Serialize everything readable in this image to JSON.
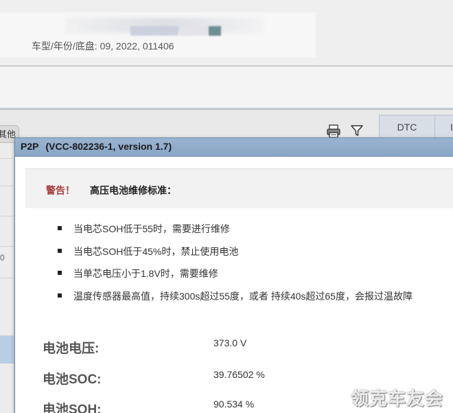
{
  "vehicle": {
    "info_label": "车型/年份/底盘:",
    "info_value": "09, 2022, 011406"
  },
  "left_panel": {
    "tab_label": "其他",
    "partial_glyph": "0"
  },
  "tabs": {
    "dtc_label": "DTC",
    "next_tab_partial": "I"
  },
  "icons": {
    "printer": "printer-icon",
    "filter": "filter-icon"
  },
  "dialog": {
    "title_prefix": "P2P",
    "title_version": "(VCC-802236-1, version 1.7)",
    "warning_label": "警告！",
    "warning_text": "高压电池维修标准：",
    "rules": [
      "当电芯SOH低于55时，需要进行维修",
      "当电芯SOH低于45%时，禁止使用电池",
      "当单芯电压小于1.8V时，需要维修",
      "温度传感器最高值，持续300s超过55度，或者 持续40s超过65度，会报过温故障"
    ],
    "metrics": [
      {
        "label": "电池电压:",
        "value": "373.0 V"
      },
      {
        "label": "电池SOC:",
        "value": "39.76502 %"
      },
      {
        "label": "电池SOH:",
        "value": "90.534 %"
      }
    ]
  },
  "watermark": "领克车友会",
  "colors": {
    "titlebar": "#8aa6c6",
    "warning_red": "#a63a3a",
    "selected_row": "#b9cde3"
  }
}
